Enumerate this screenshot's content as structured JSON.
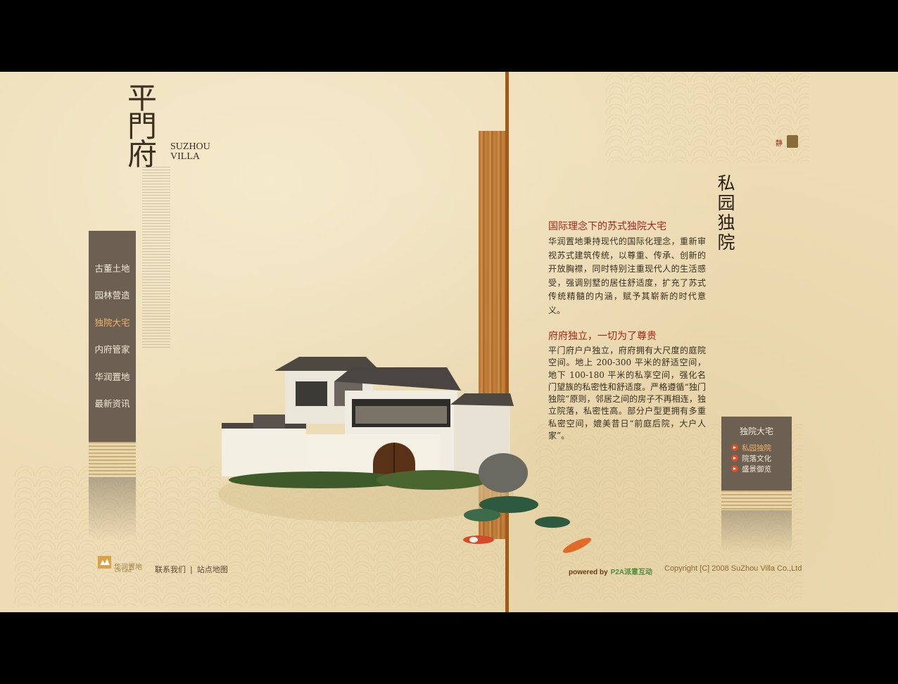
{
  "logo": {
    "chinese": "平門府",
    "english_line1": "SUZHOU",
    "english_line2": "VILLA"
  },
  "left_nav": {
    "items": [
      {
        "label": "古董土地",
        "active": false
      },
      {
        "label": "园林营造",
        "active": false
      },
      {
        "label": "独院大宅",
        "active": true
      },
      {
        "label": "内府管家",
        "active": false
      },
      {
        "label": "华润置地",
        "active": false
      },
      {
        "label": "最新资讯",
        "active": false
      }
    ]
  },
  "music_toggle": {
    "label": "静"
  },
  "page": {
    "vertical_title": "私园独院",
    "section1": {
      "heading": "国际理念下的苏式独院大宅",
      "body": "华润置地秉持现代的国际化理念，重新审视苏式建筑传统，以尊重、传承、创新的开放胸襟，同时特别注重现代人的生活感受，强调别墅的居住舒适度，扩充了苏式传统精髓的内涵，赋予其崭新的时代意义。"
    },
    "section2": {
      "heading": "府府独立，一切为了尊贵",
      "body": "平门府户户独立，府府拥有大尺度的庭院空间。地上 200-300 平米的舒适空间，地下 100-180 平米的私享空间，强化名门望族的私密性和舒适度。严格遵循“独门独院”原则，邻居之间的房子不再相连，独立院落，私密性高。部分户型更拥有多重私密空间，媲美昔日“前庭后院，大户人家”。"
    }
  },
  "sub_nav": {
    "title": "独院大宅",
    "items": [
      {
        "label": "私园独院",
        "active": true
      },
      {
        "label": "院落文化",
        "active": false
      },
      {
        "label": "盛景御览",
        "active": false
      }
    ]
  },
  "footer": {
    "brand_cn": "华润置地",
    "brand_en": "CR Land",
    "contact": "联系我们",
    "separator": "|",
    "sitemap": "站点地图",
    "powered_by": "powered by",
    "powered_company": "P2A派意互动",
    "copyright": "Copyright [C] 2008 SuZhou Villa Co.,Ltd"
  },
  "colors": {
    "background": "#eddcb4",
    "nav_panel": "#6b6052",
    "heading_red": "#a3261a",
    "active_nav": "#f2b16a",
    "divider": "#a35a18"
  }
}
